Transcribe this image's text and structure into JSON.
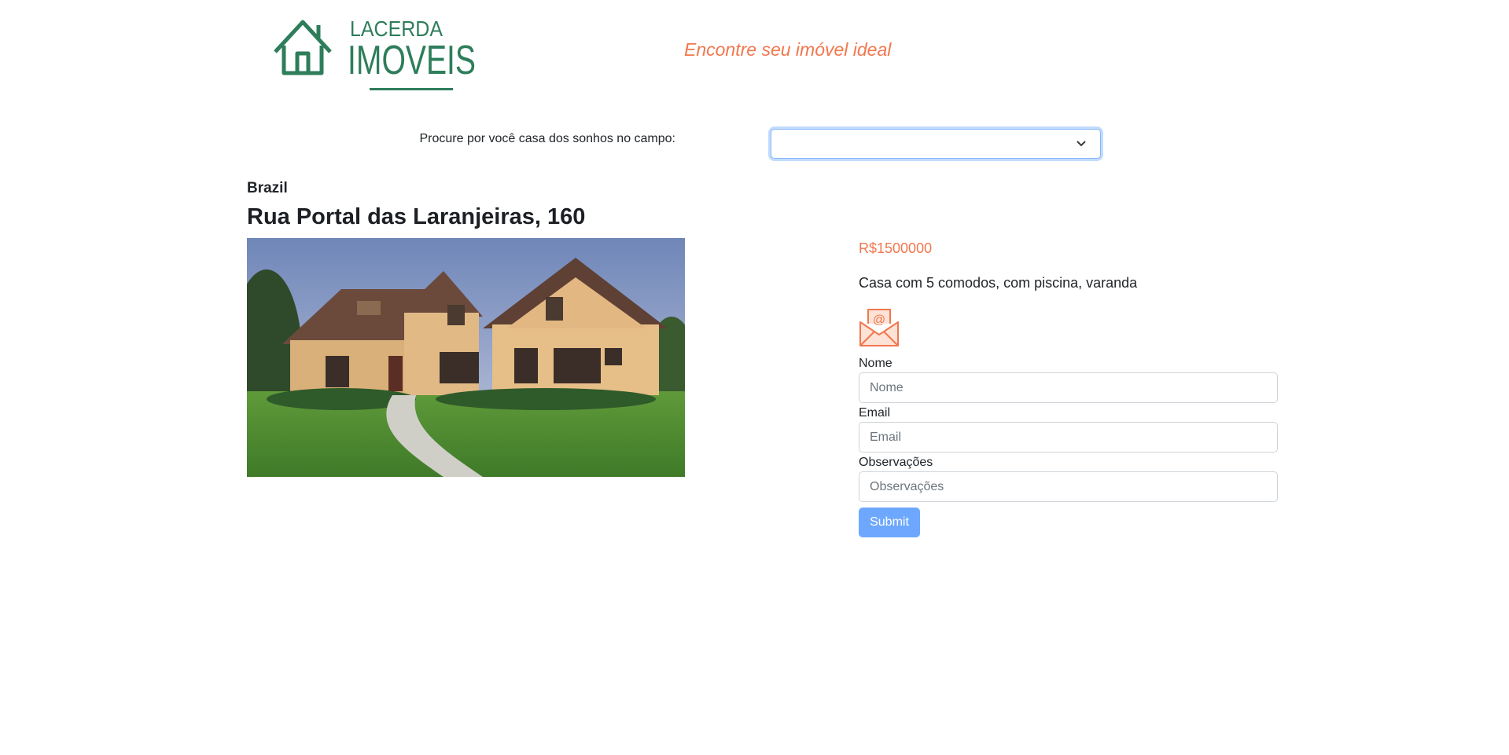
{
  "header": {
    "logo_top": "LACERDA",
    "logo_bottom": "IMOVEIS",
    "tagline": "Encontre seu imóvel ideal"
  },
  "search": {
    "label": "Procure por você casa dos sonhos no campo:",
    "selected_value": ""
  },
  "listing": {
    "country": "Brazil",
    "address": "Rua Portal das Laranjeiras, 160",
    "price": "R$1500000",
    "description": "Casa com 5 comodos, com piscina, varanda"
  },
  "contact_form": {
    "icon": "email-envelope-icon",
    "fields": [
      {
        "label": "Nome",
        "placeholder": "Nome"
      },
      {
        "label": "Email",
        "placeholder": "Email"
      },
      {
        "label": "Observações",
        "placeholder": "Observações"
      }
    ],
    "submit_label": "Submit"
  },
  "colors": {
    "brand_green": "#2e7d5b",
    "accent_orange": "#f2774e",
    "submit_blue": "#6ea8fe"
  }
}
